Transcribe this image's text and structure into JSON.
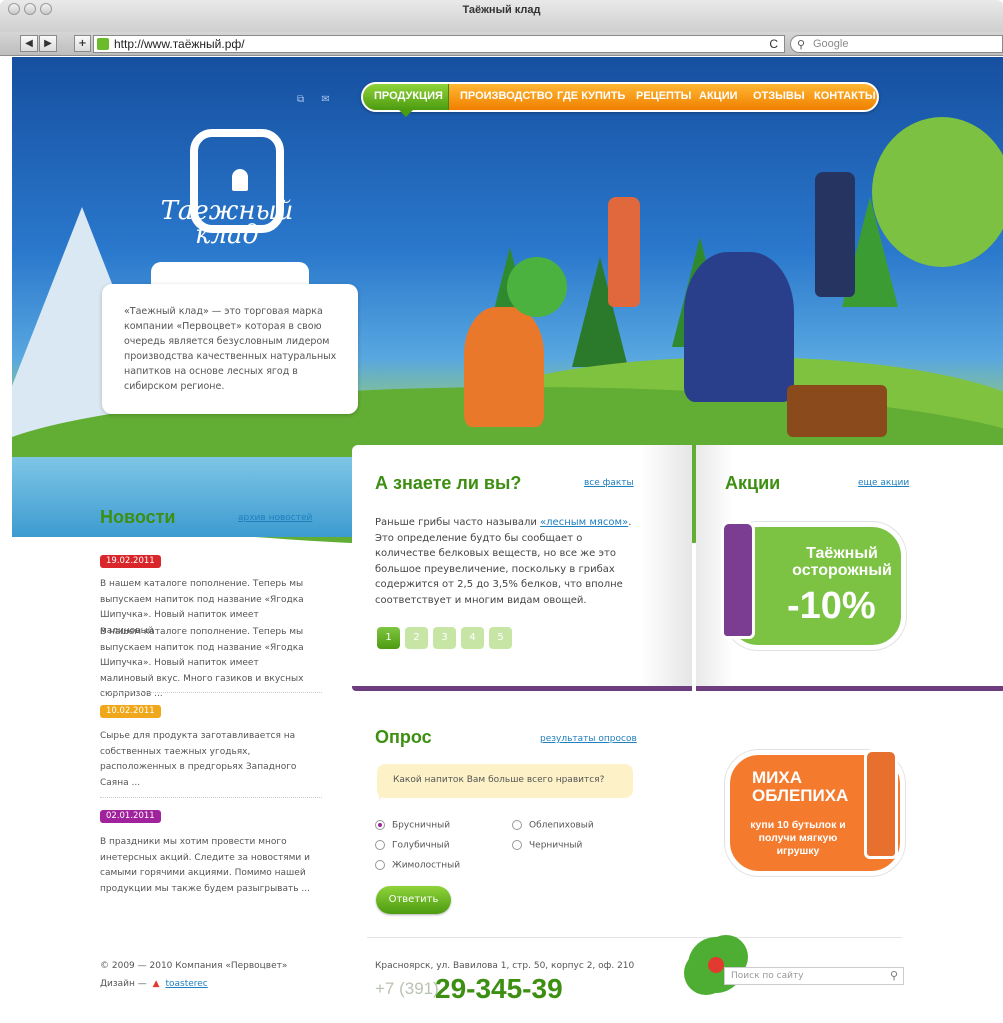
{
  "window": {
    "title": "Таёжный клад"
  },
  "toolbar": {
    "back": "◀",
    "forward": "▶",
    "add": "+",
    "url": "http://www.таёжный.рф/",
    "reload": "C",
    "search_placeholder": "Google"
  },
  "nav": {
    "items": [
      "ПРОДУКЦИЯ",
      "ПРОИЗВОДСТВО",
      "ГДЕ КУПИТЬ",
      "РЕЦЕПТЫ",
      "АКЦИИ",
      "ОТЗЫВЫ",
      "КОНТАКТЫ"
    ],
    "active": "ПРОДУКЦИЯ"
  },
  "logo": {
    "line1": "Таежный",
    "line2": "клад"
  },
  "intro": {
    "text": "«Таежный клад» — это торговая марка компании «Первоцвет» которая в свою очередь является безусловным лидером производства качественных натуральных напитков на основе лесных ягод в сибирском регионе."
  },
  "facts": {
    "title": "А знаете ли вы?",
    "link": "все факты",
    "text_before": "Раньше грибы часто называли ",
    "text_link": "«лесным мясом»",
    "text_after": ". Это определение будто бы сообщает о количестве белковых веществ, но все же это большое преувеличение, поскольку в грибах содержится от 2,5 до 3,5% белков, что вполне соответствует и многим видам овощей.",
    "pages": [
      "1",
      "2",
      "3",
      "4",
      "5"
    ],
    "active_page": "1"
  },
  "promo": {
    "title": "Акции",
    "link": "еще акции",
    "banner_title": "Таёжный осторожный",
    "banner_discount": "-10%"
  },
  "news": {
    "title": "Новости",
    "archive_link": "архив новостей",
    "items": [
      {
        "date": "19.02.2011",
        "color": "#d8262b",
        "text": "В нашем каталоге пополнение. Теперь мы выпускаем напиток под название «Ягодка Шипучка». Новый напиток имеет малиновый"
      },
      {
        "date": "",
        "color": "",
        "text": "В нашем каталоге пополнение. Теперь мы выпускаем напиток под название «Ягодка Шипучка». Новый напиток имеет малиновый вкус. Много газиков и вкусных сюрпризов ..."
      },
      {
        "date": "10.02.2011",
        "color": "#f0a81a",
        "text": "Сырье для продукта заготавливается на собственных таежных угодьях, расположенных в предгорьях Западного Саяна ..."
      },
      {
        "date": "02.01.2011",
        "color": "#a0229c",
        "text": "В праздники мы хотим провести много инетерсных акций. Следите за новостями и самыми горячими акциями. Помимо нашей продукции мы также будем разыгрывать ..."
      }
    ]
  },
  "poll": {
    "title": "Опрос",
    "results_link": "результаты опросов",
    "question": "Какой напиток Вам больше всего нравится?",
    "options": [
      "Брусничный",
      "Облепиховый",
      "Голубичный",
      "Черничный",
      "Жимолостный"
    ],
    "selected": "Брусничный",
    "button": "Ответить"
  },
  "promo2": {
    "title": "МИХА ОБЛЕПИХА",
    "text": "купи 10 бутылок и получи мягкую игрушку"
  },
  "footer": {
    "copyright": "© 2009 — 2010 Компания «Первоцвет»",
    "design_label": "Дизайн —",
    "design_link": "toasterec",
    "address": "Красноярск, ул. Вавилова 1, стр. 50, корпус 2, оф. 210",
    "phone_code": "+7 (391)",
    "phone": "29-345-39",
    "search_placeholder": "Поиск по сайту"
  },
  "colors": {
    "accent": "#3d8f12",
    "menu": "#f28a00",
    "link": "#1f7fbf"
  }
}
